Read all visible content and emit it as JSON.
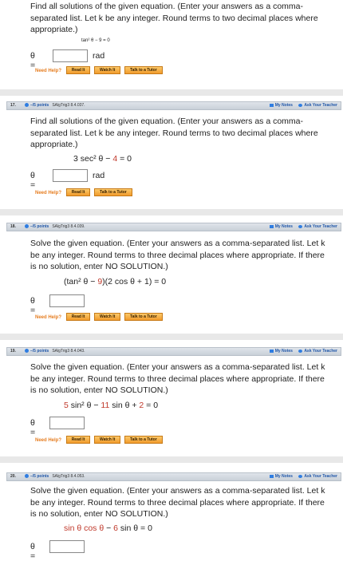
{
  "q16": {
    "prompt": "Find all solutions of the given equation. (Enter your answers as a comma-separated list. Let k be any integer. Round terms to two decimal places where appropriate.)",
    "equation": "tan² θ − 9 = 0",
    "theta": "θ =",
    "answer": "",
    "unit": "rad",
    "help_label": "Need Help?",
    "buttons": [
      "Read It",
      "Watch It",
      "Talk to a Tutor"
    ]
  },
  "q17": {
    "number": "17.",
    "points": "–/5 points",
    "code": "SAlgTrig3 8.4.037.",
    "my_notes": "My Notes",
    "ask": "Ask Your Teacher",
    "prompt": "Find all solutions of the given equation. (Enter your answers as a comma-separated list. Let k be any integer. Round terms to two decimal places where appropriate.)",
    "eq_part1": "3 sec² θ",
    "eq_part2": " − ",
    "eq_part3": "4",
    "eq_part4": " = 0",
    "theta": "θ =",
    "answer": "",
    "unit": "rad",
    "help_label": "Need Help?",
    "buttons": [
      "Read It",
      "Talk to a Tutor"
    ]
  },
  "q18": {
    "number": "18.",
    "points": "–/5 points",
    "code": "SAlgTrig3 8.4.039.",
    "my_notes": "My Notes",
    "ask": "Ask Your Teacher",
    "prompt": "Solve the given equation. (Enter your answers as a comma-separated list. Let k be any integer. Round terms to three decimal places where appropriate. If there is no solution, enter NO SOLUTION.)",
    "eq_a": "(tan² θ − ",
    "eq_b": "9",
    "eq_c": ")(2 cos θ + 1) = 0",
    "theta": "θ =",
    "answer": "",
    "help_label": "Need Help?",
    "buttons": [
      "Read It",
      "Watch It",
      "Talk to a Tutor"
    ]
  },
  "q19": {
    "number": "19.",
    "points": "–/5 points",
    "code": "SAlgTrig3 8.4.043.",
    "my_notes": "My Notes",
    "ask": "Ask Your Teacher",
    "prompt": "Solve the given equation. (Enter your answers as a comma-separated list. Let k be any integer. Round terms to three decimal places where appropriate. If there is no solution, enter NO SOLUTION.)",
    "eq_a": "5",
    "eq_b": " sin² θ − ",
    "eq_c": "11",
    "eq_d": " sin θ + ",
    "eq_e": "2",
    "eq_f": " = 0",
    "theta": "θ =",
    "answer": "",
    "help_label": "Need Help?",
    "buttons": [
      "Read It",
      "Watch It",
      "Talk to a Tutor"
    ]
  },
  "q20": {
    "number": "20.",
    "points": "–/5 points",
    "code": "SAlgTrig3 8.4.053.",
    "my_notes": "My Notes",
    "ask": "Ask Your Teacher",
    "prompt": "Solve the given equation. (Enter your answers as a comma-separated list. Let k be any integer. Round terms to three decimal places where appropriate. If there is no solution, enter NO SOLUTION.)",
    "eq_a": "sin θ cos θ",
    "eq_b": " − ",
    "eq_c": "6",
    "eq_d": " sin θ = 0",
    "theta": "θ =",
    "answer": ""
  },
  "colors": {
    "accent": "#2f7de1",
    "orange": "#f19b2c",
    "red": "#c0392b"
  }
}
